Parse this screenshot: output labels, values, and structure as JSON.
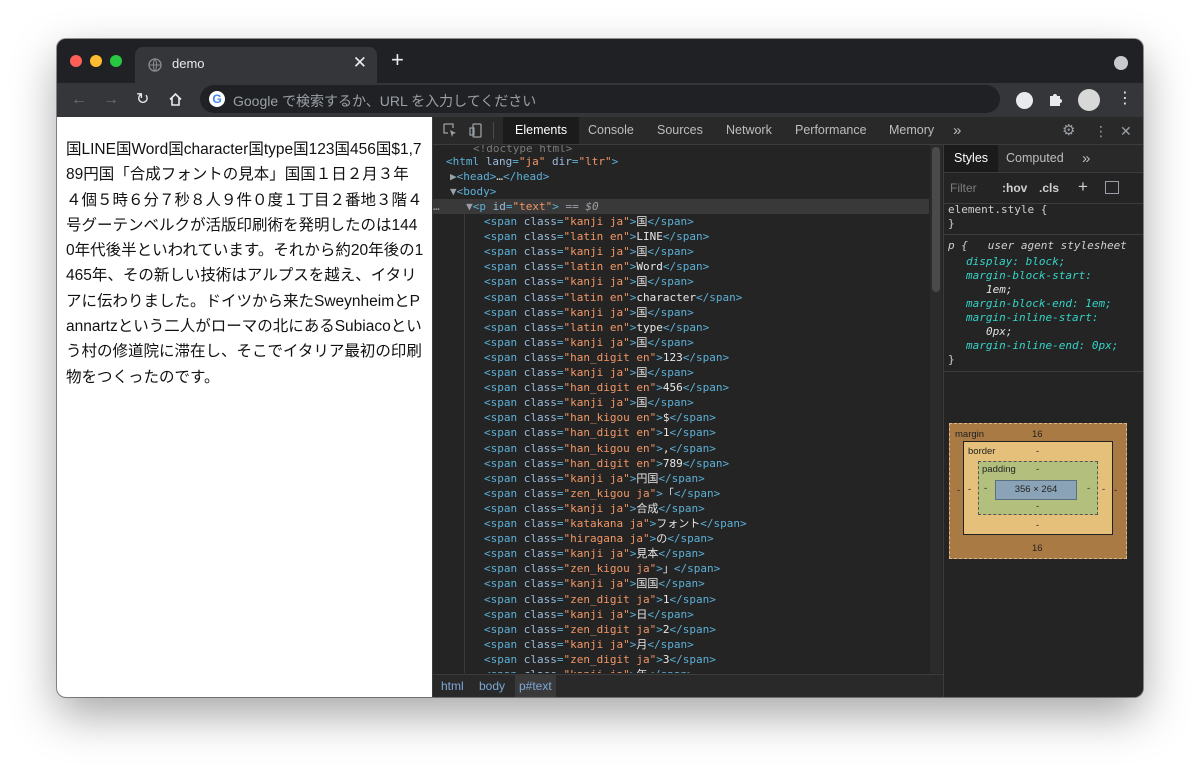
{
  "window": {
    "traffic_lights": {
      "close": "#ff5f57",
      "minimize": "#febc2e",
      "zoom": "#28c840"
    },
    "tab": {
      "title": "demo"
    }
  },
  "toolbar": {
    "omnibox_placeholder": "Google で検索するか、URL を入力してください"
  },
  "page": {
    "text": "国LINE国Word国character国type国123国456国$1,789円国「合成フォントの見本」国国１日２月３年４個５時６分７秒８人９件０度１丁目２番地３階４号グーテンベルクが活版印刷術を発明したのは1440年代後半といわれています。それから約20年後の1465年、その新しい技術はアルプスを越え、イタリアに伝わりました。ドイツから来たSweynheimとPannartzという二人がローマの北にあるSubiacoという村の修道院に滞在し、そこでイタリア最初の印刷物をつくったのです。"
  },
  "devtools": {
    "tabs": [
      "Elements",
      "Console",
      "Sources",
      "Network",
      "Performance",
      "Memory"
    ],
    "more": "»",
    "elements": {
      "lines": [
        {
          "tag": "<html lang=\"ja\" dir=\"ltr\">",
          "kind": "html"
        },
        {
          "tag": "▶<head>…</head>",
          "kind": "head"
        },
        {
          "tag": "▼<body>",
          "kind": "body"
        },
        {
          "tag": "▼<p id=\"text\"> == $0",
          "kind": "p"
        }
      ],
      "spans": [
        {
          "cls": "kanji ja",
          "t": "国"
        },
        {
          "cls": "latin en",
          "t": "LINE"
        },
        {
          "cls": "kanji ja",
          "t": "国"
        },
        {
          "cls": "latin en",
          "t": "Word"
        },
        {
          "cls": "kanji ja",
          "t": "国"
        },
        {
          "cls": "latin en",
          "t": "character"
        },
        {
          "cls": "kanji ja",
          "t": "国"
        },
        {
          "cls": "latin en",
          "t": "type"
        },
        {
          "cls": "kanji ja",
          "t": "国"
        },
        {
          "cls": "han_digit en",
          "t": "123"
        },
        {
          "cls": "kanji ja",
          "t": "国"
        },
        {
          "cls": "han_digit en",
          "t": "456"
        },
        {
          "cls": "kanji ja",
          "t": "国"
        },
        {
          "cls": "han_kigou en",
          "t": "$"
        },
        {
          "cls": "han_digit en",
          "t": "1"
        },
        {
          "cls": "han_kigou en",
          "t": ","
        },
        {
          "cls": "han_digit en",
          "t": "789"
        },
        {
          "cls": "kanji ja",
          "t": "円国"
        },
        {
          "cls": "zen_kigou ja",
          "t": "「"
        },
        {
          "cls": "kanji ja",
          "t": "合成"
        },
        {
          "cls": "katakana ja",
          "t": "フォント"
        },
        {
          "cls": "hiragana ja",
          "t": "の"
        },
        {
          "cls": "kanji ja",
          "t": "見本"
        },
        {
          "cls": "zen_kigou ja",
          "t": "」"
        },
        {
          "cls": "kanji ja",
          "t": "国国"
        },
        {
          "cls": "zen_digit ja",
          "t": "1"
        },
        {
          "cls": "kanji ja",
          "t": "日"
        },
        {
          "cls": "zen_digit ja",
          "t": "2"
        },
        {
          "cls": "kanji ja",
          "t": "月"
        },
        {
          "cls": "zen_digit ja",
          "t": "3"
        },
        {
          "cls": "kanji ja",
          "t": "年"
        }
      ]
    },
    "breadcrumbs": [
      "html",
      "body",
      "p#text"
    ],
    "styles": {
      "tabs": [
        "Styles",
        "Computed",
        "»"
      ],
      "filter_placeholder": "Filter",
      "hov": ":hov",
      "cls": ".cls",
      "rules": [
        "element.style {",
        "}",
        "p {   user agent stylesheet",
        "display: block;",
        "margin-block-start:",
        "1em;",
        "margin-block-end: 1em;",
        "margin-inline-start:",
        "0px;",
        "margin-inline-end: 0px;",
        "}"
      ],
      "box_model": {
        "margin_label": "margin",
        "margin_top": "16",
        "margin_bottom": "16",
        "margin_side": "-",
        "border_label": "border",
        "border_value": "-",
        "padding_label": "padding",
        "padding_value": "-",
        "content": "356 × 264"
      }
    }
  }
}
